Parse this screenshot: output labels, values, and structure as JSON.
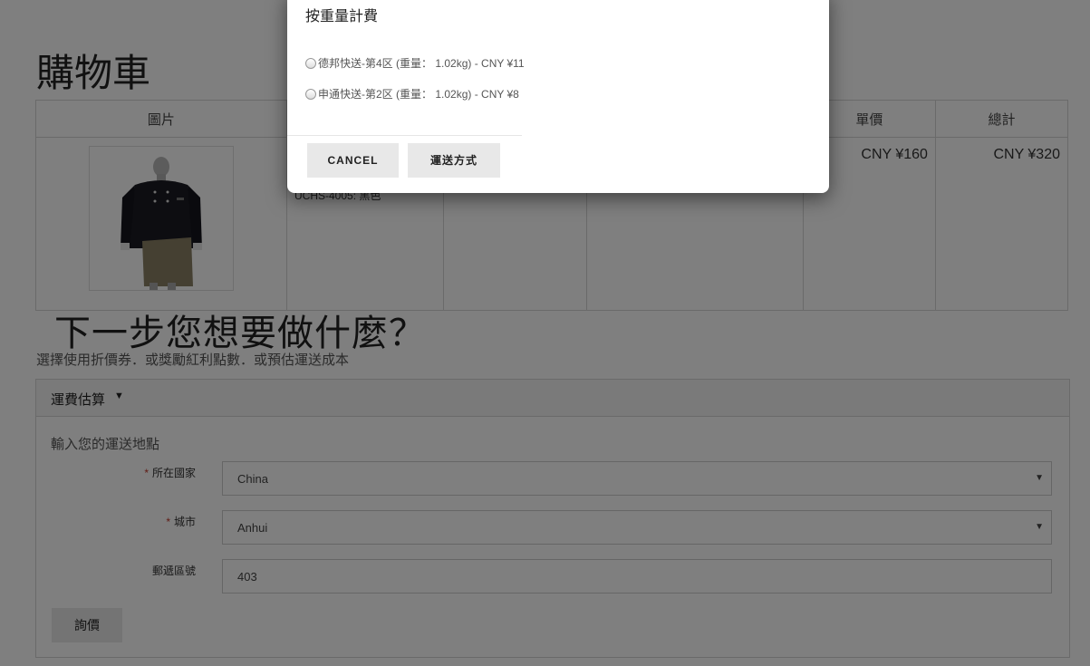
{
  "page": {
    "title": "購物車"
  },
  "cart": {
    "headers": [
      "圖片",
      "",
      "",
      "",
      "單價",
      "總計"
    ],
    "item": {
      "model_text": "UCHS-4005: 黑色",
      "unit_price": "CNY ¥160",
      "total_price": "CNY ¥320"
    }
  },
  "next": {
    "title": "下一步您想要做什麼？",
    "subtitle": "選擇使用折價券．或獎勵紅利點數．或預估運送成本"
  },
  "shipping": {
    "panel_title": "運費估算",
    "lead": "輸入您的運送地點",
    "country_label": "所在國家",
    "country_value": "China",
    "city_label": "城市",
    "city_value": "Anhui",
    "postcode_label": "郵遞區號",
    "postcode_value": "403",
    "quote_button": "詢價",
    "required_mark": "*"
  },
  "modal": {
    "title": "按重量計費",
    "options": [
      "德邦快送-第4区 (重量： 1.02kg) - CNY ¥11",
      "申通快送-第2区 (重量： 1.02kg) - CNY ¥8"
    ],
    "cancel_label": "CANCEL",
    "confirm_label": "運送方式"
  },
  "icons": {
    "caret": "caret-down-icon",
    "select_arrow": "select-arrow-icon",
    "radio": "radio-icon"
  },
  "colors": {
    "overlay": "#000000",
    "required": "#c0392b",
    "button_bg": "#e8e8e8"
  }
}
